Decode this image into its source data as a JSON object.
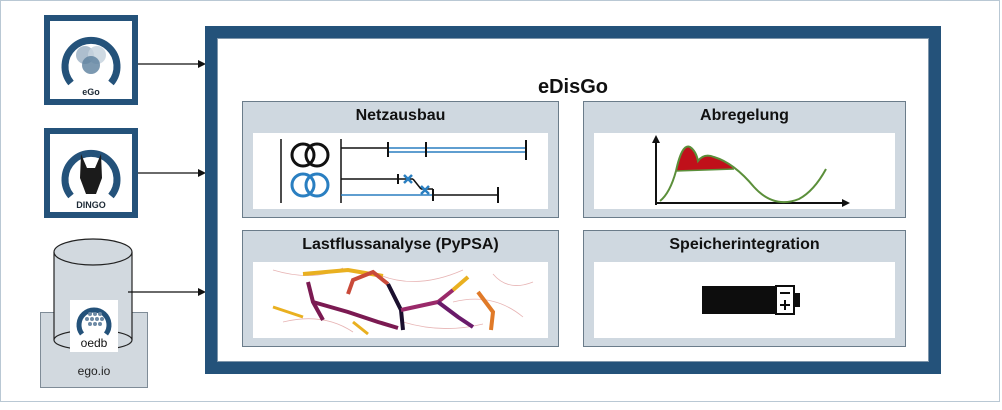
{
  "main": {
    "title": "eDisGo",
    "panels": [
      {
        "title": "Netzausbau"
      },
      {
        "title": "Abregelung"
      },
      {
        "title": "Lastflussanalyse (PyPSA)"
      },
      {
        "title": "Speicherintegration"
      }
    ]
  },
  "inputs": {
    "ego_label": "eGo",
    "dingo_label": "DINGO",
    "oedb_label": "oedb",
    "egoio_label": "ego.io"
  },
  "colors": {
    "frame": "#24527a",
    "panel_bg": "#cfd8e0",
    "line_blue": "#2a7fc1",
    "curtail_red": "#c0101a",
    "curve_green": "#5b8f3a"
  }
}
